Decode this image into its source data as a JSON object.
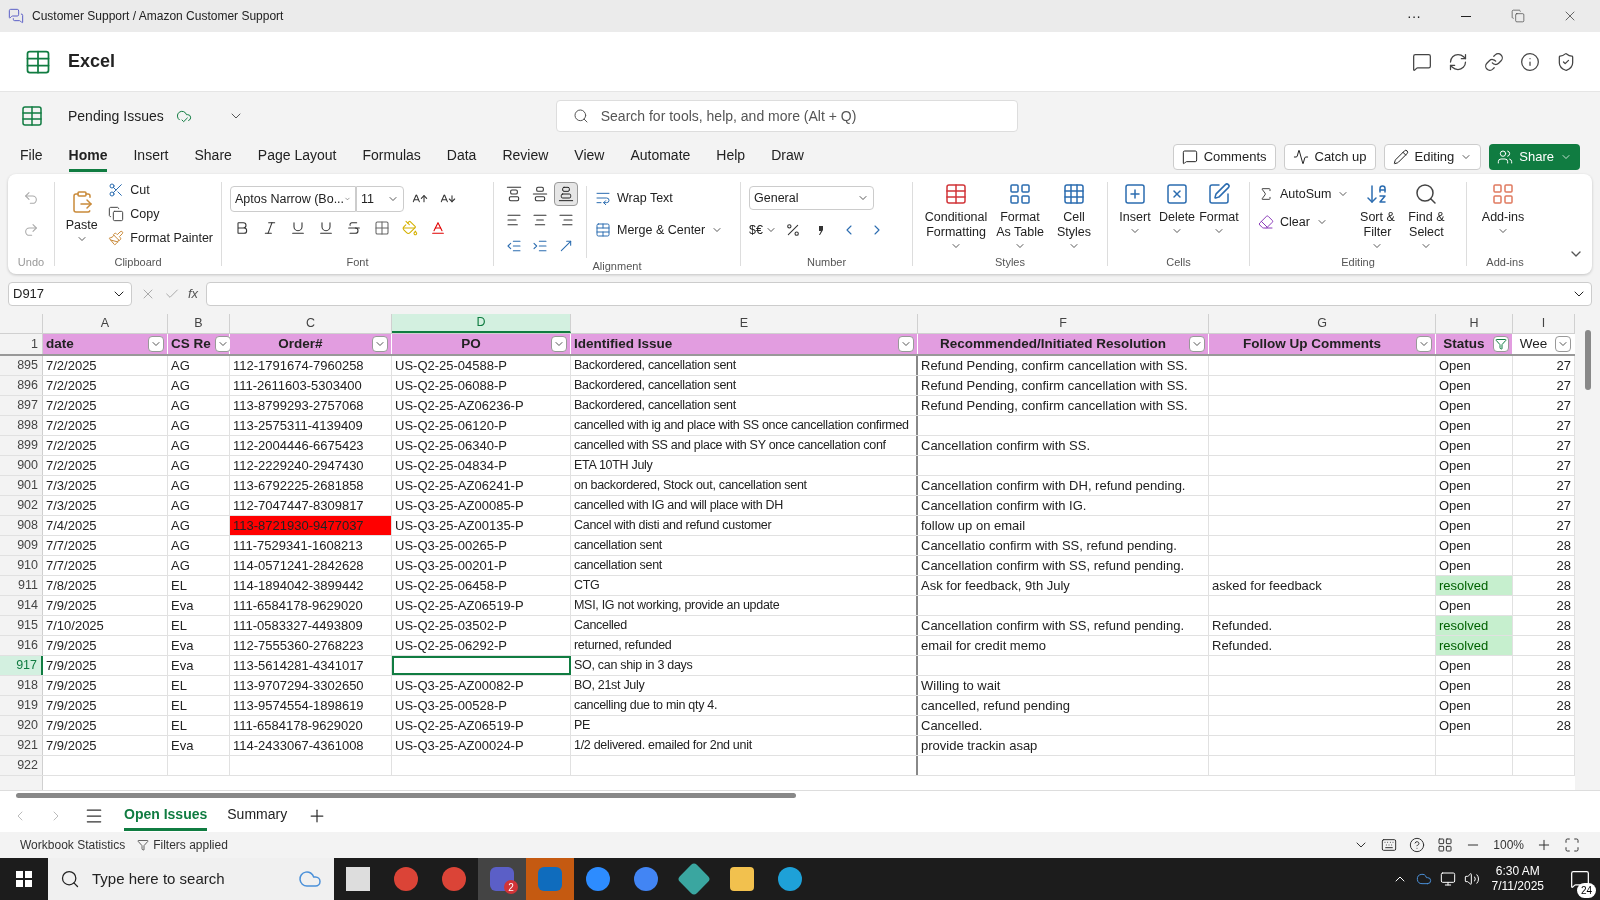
{
  "window": {
    "title": "Customer Support / Amazon Customer Support",
    "more": "···"
  },
  "app": {
    "name": "Excel"
  },
  "file": {
    "name": "Pending Issues",
    "search_placeholder": "Search for tools, help, and more (Alt + Q)"
  },
  "menu": [
    {
      "label": "File",
      "selected": false
    },
    {
      "label": "Home",
      "selected": true
    },
    {
      "label": "Insert",
      "selected": false
    },
    {
      "label": "Share",
      "selected": false
    },
    {
      "label": "Page Layout",
      "selected": false
    },
    {
      "label": "Formulas",
      "selected": false
    },
    {
      "label": "Data",
      "selected": false
    },
    {
      "label": "Review",
      "selected": false
    },
    {
      "label": "View",
      "selected": false
    },
    {
      "label": "Automate",
      "selected": false
    },
    {
      "label": "Help",
      "selected": false
    },
    {
      "label": "Draw",
      "selected": false
    }
  ],
  "actions": {
    "comments": "Comments",
    "catch_up": "Catch up",
    "editing": "Editing",
    "share": "Share"
  },
  "ribbon": {
    "undo": {
      "label": "Undo"
    },
    "clipboard": {
      "paste": "Paste",
      "cut": "Cut",
      "copy": "Copy",
      "format_painter": "Format Painter",
      "label": "Clipboard"
    },
    "font": {
      "name": "Aptos Narrow (Bo...",
      "size": "11",
      "label": "Font"
    },
    "alignment": {
      "wrap": "Wrap Text",
      "merge": "Merge & Center",
      "label": "Alignment"
    },
    "number": {
      "format": "General",
      "currency": "$€",
      "label": "Number"
    },
    "styles": {
      "items": [
        "Conditional Formatting",
        "Format As Table",
        "Cell Styles"
      ],
      "label": "Styles"
    },
    "cells": {
      "items": [
        "Insert",
        "Delete",
        "Format"
      ],
      "label": "Cells"
    },
    "editing": {
      "autosum": "AutoSum",
      "clear": "Clear",
      "sort": "Sort & Filter",
      "find": "Find & Select",
      "label": "Editing"
    },
    "addins": {
      "button": "Add-ins",
      "label": "Add-ins"
    }
  },
  "formula_bar": {
    "name_box": "D917",
    "fx": "fx"
  },
  "table": {
    "columns": [
      {
        "letter": "A",
        "header": "date",
        "selected": false,
        "filtered": false
      },
      {
        "letter": "B",
        "header": "CS Re",
        "selected": false,
        "filtered": false
      },
      {
        "letter": "C",
        "header": "Order#",
        "selected": false,
        "filtered": false
      },
      {
        "letter": "D",
        "header": "PO",
        "selected": true,
        "filtered": false
      },
      {
        "letter": "E",
        "header": "Identified Issue",
        "selected": false,
        "filtered": false
      },
      {
        "letter": "F",
        "header": "Recommended/Initiated Resolution",
        "selected": false,
        "filtered": false
      },
      {
        "letter": "G",
        "header": "Follow Up Comments",
        "selected": false,
        "filtered": false
      },
      {
        "letter": "H",
        "header": "Status",
        "selected": false,
        "filtered": true
      },
      {
        "letter": "I",
        "header": "Wee",
        "selected": false,
        "filtered": false
      }
    ],
    "header_row": "1",
    "rows": [
      {
        "number": "895",
        "date": "7/2/2025",
        "cs_rep": "AG",
        "order": "112-1791674-7960258",
        "po": "US-Q2-25-04588-P",
        "issue": "Backordered, cancellation sent",
        "resolution": "Refund Pending, confirm cancellation with SS.",
        "status": "Open",
        "status_highlighted": false,
        "week": "27",
        "selected": false,
        "order_highlighted": false
      },
      {
        "number": "896",
        "date": "7/2/2025",
        "cs_rep": "AG",
        "order": "111-2611603-5303400",
        "po": "US-Q2-25-06088-P",
        "issue": "Backordered, cancellation sent",
        "resolution": "Refund Pending, confirm cancellation with SS.",
        "status": "Open",
        "status_highlighted": false,
        "week": "27",
        "selected": false,
        "order_highlighted": false
      },
      {
        "number": "897",
        "date": "7/2/2025",
        "cs_rep": "AG",
        "order": "113-8799293-2757068",
        "po": "US-Q2-25-AZ06236-P",
        "issue": "Backordered, cancellation sent",
        "resolution": "Refund Pending, confirm cancellation with SS.",
        "status": "Open",
        "status_highlighted": false,
        "week": "27",
        "selected": false,
        "order_highlighted": false
      },
      {
        "number": "898",
        "date": "7/2/2025",
        "cs_rep": "AG",
        "order": "113-2575311-4139409",
        "po": "US-Q2-25-06120-P",
        "issue": "cancelled with ig and place with SS once cancellation confirmed",
        "status": "Open",
        "status_highlighted": false,
        "week": "27",
        "selected": false,
        "order_highlighted": false
      },
      {
        "number": "899",
        "date": "7/2/2025",
        "cs_rep": "AG",
        "order": "112-2004446-6675423",
        "po": "US-Q2-25-06340-P",
        "issue": "cancelled with SS and place with SY once cancellation conf",
        "resolution": "Cancellation confirm with SS.",
        "status": "Open",
        "status_highlighted": false,
        "week": "27",
        "selected": false,
        "order_highlighted": false
      },
      {
        "number": "900",
        "date": "7/2/2025",
        "cs_rep": "AG",
        "order": "112-2229240-2947430",
        "po": "US-Q2-25-04834-P",
        "issue": "ETA 10TH July",
        "status": "Open",
        "status_highlighted": false,
        "week": "27",
        "selected": false,
        "order_highlighted": false
      },
      {
        "number": "901",
        "date": "7/3/2025",
        "cs_rep": "AG",
        "order": "113-6792225-2681858",
        "po": "US-Q2-25-AZ06241-P",
        "issue": "on backordered, Stock out, cancellation sent",
        "resolution": "Cancellation confirm with DH, refund pending.",
        "status": "Open",
        "status_highlighted": false,
        "week": "27",
        "selected": false,
        "order_highlighted": false
      },
      {
        "number": "902",
        "date": "7/3/2025",
        "cs_rep": "AG",
        "order": "112-7047447-8309817",
        "po": "US-Q3-25-AZ00085-P",
        "issue": "cancelled with IG and will place with DH",
        "resolution": "Cancellation confirm with IG.",
        "status": "Open",
        "status_highlighted": false,
        "week": "27",
        "selected": false,
        "order_highlighted": false
      },
      {
        "number": "908",
        "date": "7/4/2025",
        "cs_rep": "AG",
        "order": "113-8721930-9477037",
        "po": "US-Q3-25-AZ00135-P",
        "issue": "Cancel with disti and refund customer",
        "resolution": "follow up on email",
        "status": "Open",
        "status_highlighted": false,
        "week": "27",
        "selected": false,
        "order_highlighted": true
      },
      {
        "number": "909",
        "date": "7/7/2025",
        "cs_rep": "AG",
        "order": "111-7529341-1608213",
        "po": "US-Q3-25-00265-P",
        "issue": "cancellation sent",
        "resolution": "Cancellatio confirm with SS, refund pending.",
        "status": "Open",
        "status_highlighted": false,
        "week": "28",
        "selected": false,
        "order_highlighted": false
      },
      {
        "number": "910",
        "date": "7/7/2025",
        "cs_rep": "AG",
        "order": "114-0571241-2842628",
        "po": "US-Q3-25-00201-P",
        "issue": "cancellation sent",
        "resolution": "Cancellation confirm with SS, refund pending.",
        "status": "Open",
        "status_highlighted": false,
        "week": "28",
        "selected": false,
        "order_highlighted": false
      },
      {
        "number": "911",
        "date": "7/8/2025",
        "cs_rep": "EL",
        "order": "114-1894042-3899442",
        "po": "US-Q2-25-06458-P",
        "issue": "CTG",
        "resolution": "Ask for feedback, 9th July",
        "follow_up": "asked for feedback",
        "status": "resolved",
        "status_highlighted": true,
        "week": "28",
        "selected": false,
        "order_highlighted": false
      },
      {
        "number": "914",
        "date": "7/9/2025",
        "cs_rep": "Eva",
        "order": "111-6584178-9629020",
        "po": "US-Q2-25-AZ06519-P",
        "issue": "MSI, IG not working, provide an update",
        "status": "Open",
        "status_highlighted": false,
        "week": "28",
        "selected": false,
        "order_highlighted": false
      },
      {
        "number": "915",
        "date": "7/10/2025",
        "cs_rep": "EL",
        "order": "111-0583327-4493809",
        "po": "US-Q2-25-03502-P",
        "issue": "Cancelled",
        "resolution": "Cancellation confirm with SS, refund pending.",
        "follow_up": "Refunded.",
        "status": "resolved",
        "status_highlighted": true,
        "week": "28",
        "selected": false,
        "order_highlighted": false
      },
      {
        "number": "916",
        "date": "7/9/2025",
        "cs_rep": "Eva",
        "order": "112-7555360-2768223",
        "po": "US-Q2-25-06292-P",
        "issue": "returned, refunded",
        "resolution": "email for credit memo",
        "follow_up": "Refunded.",
        "status": "resolved",
        "status_highlighted": true,
        "week": "28",
        "selected": false,
        "order_highlighted": false
      },
      {
        "number": "917",
        "date": "7/9/2025",
        "cs_rep": "Eva",
        "order": "113-5614281-4341017",
        "issue": "SO, can ship in 3 days",
        "status": "Open",
        "status_highlighted": false,
        "week": "28",
        "selected": true,
        "order_highlighted": false
      },
      {
        "number": "918",
        "date": "7/9/2025",
        "cs_rep": "EL",
        "order": "113-9707294-3302650",
        "po": "US-Q3-25-AZ00082-P",
        "issue": "BO, 21st July",
        "resolution": "Willing to wait",
        "status": "Open",
        "status_highlighted": false,
        "week": "28",
        "selected": false,
        "order_highlighted": false
      },
      {
        "number": "919",
        "date": "7/9/2025",
        "cs_rep": "EL",
        "order": "113-9574554-1898619",
        "po": "US-Q3-25-00528-P",
        "issue": "cancelling due to min qty 4.",
        "resolution": "cancelled, refund pending",
        "status": "Open",
        "status_highlighted": false,
        "week": "28",
        "selected": false,
        "order_highlighted": false
      },
      {
        "number": "920",
        "date": "7/9/2025",
        "cs_rep": "EL",
        "order": "111-6584178-9629020",
        "po": "US-Q2-25-AZ06519-P",
        "issue": "PE",
        "resolution": "Cancelled.",
        "status": "Open",
        "status_highlighted": false,
        "week": "28",
        "selected": false,
        "order_highlighted": false
      },
      {
        "number": "921",
        "date": "7/9/2025",
        "cs_rep": "Eva",
        "order": "114-2433067-4361008",
        "po": "US-Q3-25-AZ00024-P",
        "issue": "1/2 delivered. emailed for 2nd unit",
        "resolution": "provide trackin asap",
        "selected": false,
        "order_highlighted": false
      },
      {
        "number": "922",
        "selected": false,
        "order_highlighted": false
      }
    ]
  },
  "sheets": [
    {
      "label": "Open Issues",
      "selected": true
    },
    {
      "label": "Summary",
      "selected": false
    }
  ],
  "status_bar": {
    "statistics": "Workbook Statistics",
    "filters": "Filters applied",
    "zoom": "100%"
  },
  "taskbar": {
    "search_placeholder": "Type here to search",
    "teams_badge": "2",
    "time": "6:30 AM",
    "date": "7/11/2025",
    "notifications": "24"
  }
}
